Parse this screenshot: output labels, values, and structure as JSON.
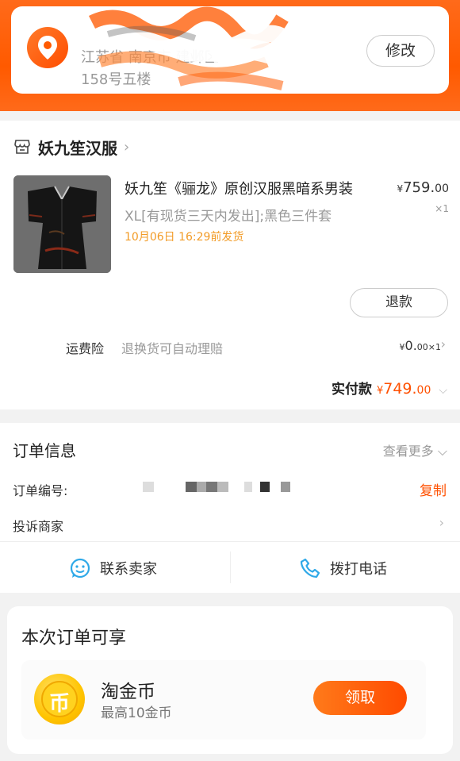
{
  "address": {
    "line1": "江苏省 南京市 建邺区",
    "line2": "158号五楼",
    "edit_label": "修改"
  },
  "shop": {
    "name": "妖九笙汉服"
  },
  "product": {
    "title": "妖九笙《骊龙》原创汉服黑暗系男装",
    "price_currency": "¥",
    "price_int": "759.",
    "price_dec": "00",
    "sku": "XL[有现货三天内发出];黑色三件套",
    "qty": "×1",
    "ship_note": "10月06日 16:29前发货",
    "refund_label": "退款"
  },
  "insurance": {
    "label": "运费险",
    "desc": "退换货可自动理赔",
    "price_currency": "¥",
    "price_int": "0.",
    "price_dec": "00",
    "qty": "×1"
  },
  "payment": {
    "label": "实付款",
    "currency": "¥",
    "int": "749.",
    "dec": "00"
  },
  "order_info": {
    "title": "订单信息",
    "more_label": "查看更多",
    "order_no_label": "订单编号:",
    "copy_label": "复制",
    "complain_label": "投诉商家",
    "contact_label": "联系卖家",
    "call_label": "拨打电话"
  },
  "benefit": {
    "title": "本次订单可享",
    "name": "淘金币",
    "sub": "最高10金币",
    "claim_label": "领取",
    "coin_glyph": "币"
  },
  "colors": {
    "accent": "#ff5000",
    "ship_note": "#f29b26"
  }
}
